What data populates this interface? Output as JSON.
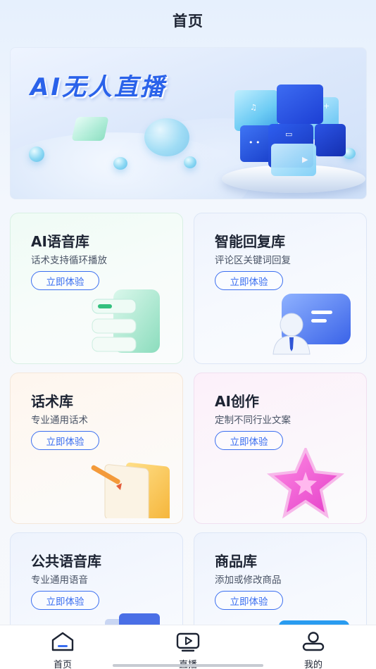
{
  "header": {
    "title": "首页"
  },
  "banner": {
    "headline": "AI无人直播"
  },
  "cards": [
    {
      "title": "AI语音库",
      "subtitle": "话术支持循环播放",
      "button": "立即体验"
    },
    {
      "title": "智能回复库",
      "subtitle": "评论区关键词回复",
      "button": "立即体验"
    },
    {
      "title": "话术库",
      "subtitle": "专业通用话术",
      "button": "立即体验"
    },
    {
      "title": "AI创作",
      "subtitle": "定制不同行业文案",
      "button": "立即体验"
    },
    {
      "title": "公共语音库",
      "subtitle": "专业通用语音",
      "button": "立即体验"
    },
    {
      "title": "商品库",
      "subtitle": "添加或修改商品",
      "button": "立即体验"
    }
  ],
  "tabbar": {
    "items": [
      {
        "label": "首页",
        "icon": "home-icon"
      },
      {
        "label": "直播",
        "icon": "live-icon"
      },
      {
        "label": "我的",
        "icon": "profile-icon"
      }
    ]
  },
  "colors": {
    "accent": "#3a6ef0",
    "brand": "#2a62ea",
    "text": "#1d2433"
  }
}
